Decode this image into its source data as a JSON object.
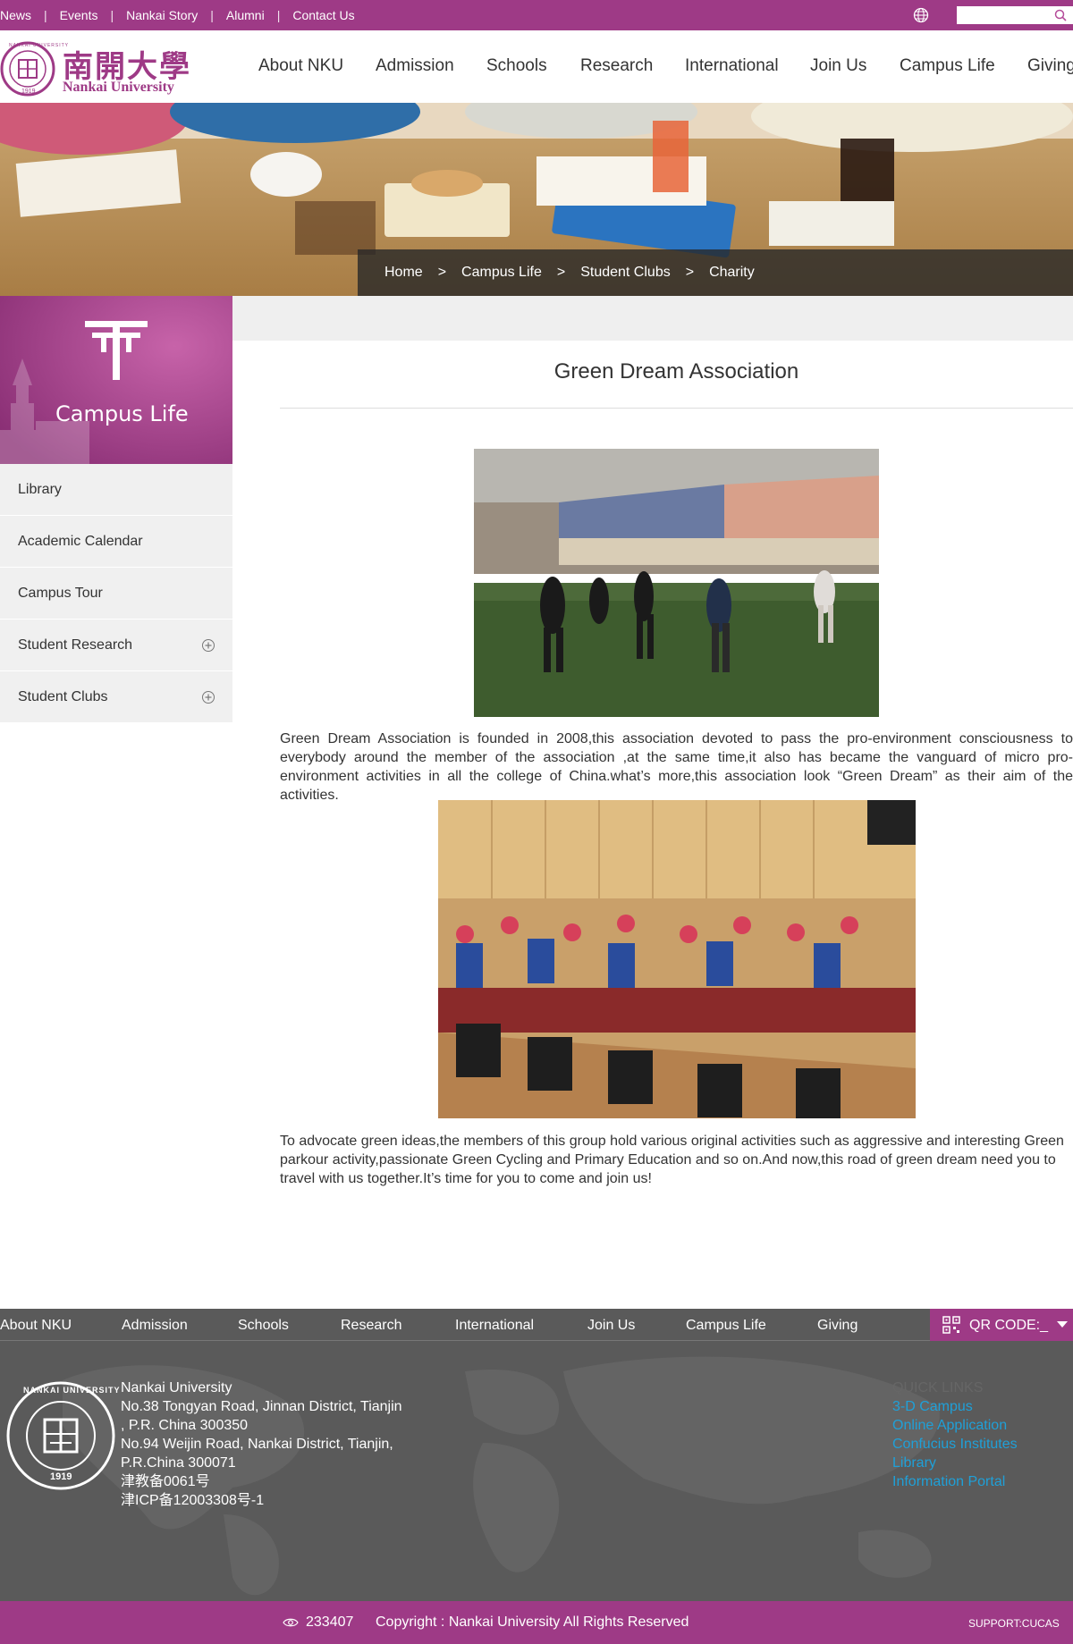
{
  "topbar": {
    "links": [
      "News",
      "Events",
      "Nankai Story",
      "Alumni",
      "Contact Us"
    ],
    "separator": "|",
    "search_placeholder": ""
  },
  "header": {
    "logo_text_cn": "南開大學",
    "logo_text_en": "Nankai University",
    "logo_seal_text": "NANKAI UNIVERSITY",
    "logo_seal_year": "1919",
    "nav": [
      "About NKU",
      "Admission",
      "Schools",
      "Research",
      "International",
      "Join Us",
      "Campus Life",
      "Giving"
    ]
  },
  "breadcrumb": {
    "items": [
      "Home",
      "Campus Life",
      "Student Clubs",
      "Charity"
    ],
    "separator": ">"
  },
  "sidebar": {
    "title": "Campus Life",
    "items": [
      {
        "label": "Library",
        "expandable": false
      },
      {
        "label": "Academic Calendar",
        "expandable": false
      },
      {
        "label": "Campus Tour",
        "expandable": false
      },
      {
        "label": "Student Research",
        "expandable": true
      },
      {
        "label": "Student Clubs",
        "expandable": true
      }
    ]
  },
  "article": {
    "title": "Green Dream Association",
    "paragraph1": "Green Dream Association is founded in 2008,this association devoted to pass the pro-environment consciousness to everybody around the member of the association ,at the same time,it also has became the vanguard of micro pro-environment activities in all the college of China.what’s more,this association look “Green Dream” as their aim of the activities.",
    "paragraph2": "To advocate green ideas,the members of this group hold various original activities such as aggressive and interesting Green parkour activity,passionate Green Cycling and Primary Education and so on.And now,this road of green dream need you to travel with us together.It’s time for you to come and join us!"
  },
  "footer": {
    "nav": [
      "About NKU",
      "Admission",
      "Schools",
      "Research",
      "International",
      "Join Us",
      "Campus Life",
      "Giving"
    ],
    "qr_label": "QR CODE:_",
    "address_lines": [
      "Nankai University",
      "No.38 Tongyan Road, Jinnan District, Tianjin",
      ", P.R. China 300350",
      "No.94 Weijin Road,  Nankai District, Tianjin,",
      "P.R.China  300071",
      "津教备0061号",
      "津ICP备12003308号-1"
    ],
    "quick_links_title": "QUICK LINKS",
    "quick_links": [
      "3-D Campus",
      "Online Application",
      "Confucius Institutes",
      "Library",
      "Information Portal"
    ],
    "seal_text": "NANKAI UNIVERSITY",
    "seal_year": "1919"
  },
  "bottom": {
    "visits": "233407",
    "copyright": "Copyright : Nankai University All Rights Reserved",
    "support": "SUPPORT:CUCAS"
  },
  "colors": {
    "brand": "#9e3a86",
    "footer_bg": "#5a5a5a",
    "link": "#1fa0d8"
  }
}
